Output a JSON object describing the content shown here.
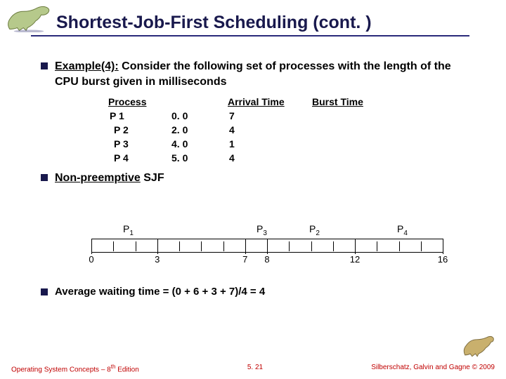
{
  "title": "Shortest-Job-First Scheduling (cont. )",
  "bullet1": {
    "lead": "Example(4):",
    "rest": " Consider the following set of processes with the length of the CPU burst given in milliseconds"
  },
  "table": {
    "headers": {
      "process": "Process",
      "arrival": "Arrival Time",
      "burst": "Burst Time"
    },
    "rows": [
      {
        "p": "P 1",
        "a": "0. 0",
        "aval": "7"
      },
      {
        "p": "P 2",
        "a": "2. 0",
        "aval": "4"
      },
      {
        "p": "P 3",
        "a": "4. 0",
        "aval": "1"
      },
      {
        "p": "P 4",
        "a": "5. 0",
        "aval": "4"
      }
    ]
  },
  "bullet2": {
    "lead": "Non-preemptive",
    "rest": " SJF"
  },
  "gantt": {
    "labels": [
      {
        "name": "P",
        "sub": "1",
        "percent": 9
      },
      {
        "name": "P",
        "sub": "3",
        "percent": 47
      },
      {
        "name": "P",
        "sub": "2",
        "percent": 62
      },
      {
        "name": "P",
        "sub": "4",
        "percent": 87
      }
    ],
    "ticks": [
      0,
      18.75,
      43.75,
      50,
      75,
      100
    ],
    "minor": [
      6.25,
      12.5,
      25,
      31.25,
      37.5,
      56.25,
      62.5,
      68.75,
      81.25,
      87.5,
      93.75
    ],
    "nums": [
      {
        "v": "0",
        "percent": 0
      },
      {
        "v": "3",
        "percent": 18.75
      },
      {
        "v": "7",
        "percent": 43.75
      },
      {
        "v": "8",
        "percent": 50
      },
      {
        "v": "12",
        "percent": 75
      },
      {
        "v": "16",
        "percent": 100
      }
    ]
  },
  "bullet3": "Average waiting time = (0 + 6 + 3 + 7)/4  = 4",
  "footer": {
    "left_a": "Operating System Concepts – 8",
    "left_b": "th",
    "left_c": " Edition",
    "mid": "5. 21",
    "right": "Silberschatz, Galvin and Gagne © 2009"
  },
  "chart_data": {
    "type": "table",
    "title": "SJF non-preemptive example",
    "columns": [
      "Process",
      "Arrival Time",
      "Burst Time"
    ],
    "rows": [
      [
        "P1",
        0.0,
        7
      ],
      [
        "P2",
        2.0,
        4
      ],
      [
        "P3",
        4.0,
        1
      ],
      [
        "P4",
        5.0,
        4
      ]
    ],
    "gantt_schedule": [
      {
        "process": "P1",
        "start": 0,
        "end": 7
      },
      {
        "process": "P3",
        "start": 7,
        "end": 8
      },
      {
        "process": "P2",
        "start": 8,
        "end": 12
      },
      {
        "process": "P4",
        "start": 12,
        "end": 16
      }
    ],
    "tick_marks": [
      0,
      3,
      7,
      8,
      12,
      16
    ],
    "average_waiting_time": 4
  }
}
